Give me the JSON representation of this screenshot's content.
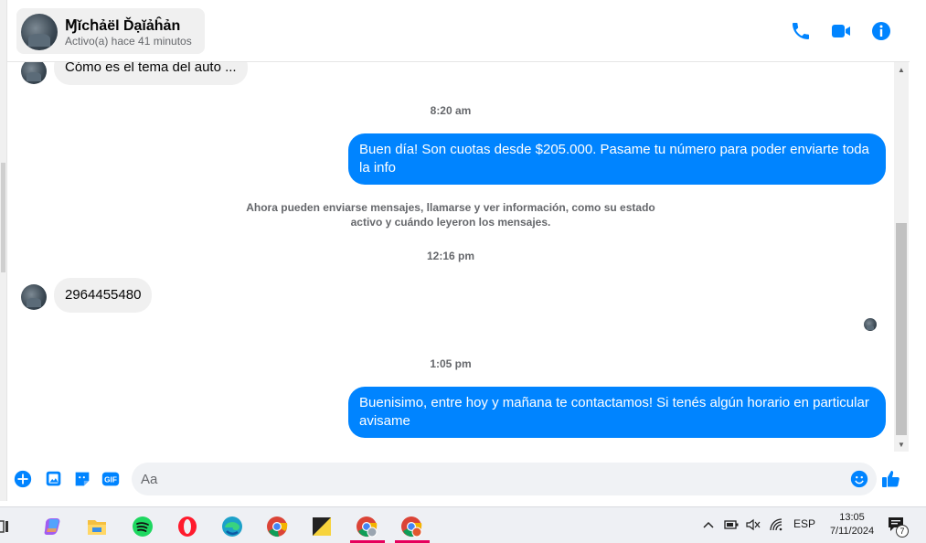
{
  "header": {
    "contact_name": "Ɱĭcհảël Ďạĭảĥản",
    "status": "Activo(a) hace 41 minutos"
  },
  "messages": {
    "prev_incoming": "Cómo es el tema del auto ...",
    "time_1": "8:20 am",
    "outgoing_1": "Buen día! Son cuotas desde $205.000. Pasame tu número para poder enviarte toda la info",
    "system_line_1": "Ahora pueden enviarse mensajes, llamarse y ver información, como su estado",
    "system_line_2": "activo y cuándo leyeron los mensajes.",
    "time_2": "12:16 pm",
    "incoming_1": "2964455480",
    "time_3": "1:05 pm",
    "outgoing_2": "Buenisimo, entre hoy y mañana te contactamos! Si tenés algún horario en particular avisame"
  },
  "composer": {
    "placeholder": "Aa"
  },
  "taskbar": {
    "language": "ESP",
    "time": "13:05",
    "date": "7/11/2024",
    "notification_count": "7"
  },
  "colors": {
    "accent": "#0084ff",
    "incoming_bubble": "#f0f0f0"
  },
  "icons": [
    "phone-icon",
    "video-icon",
    "info-icon",
    "plus-icon",
    "image-icon",
    "sticker-icon",
    "gif-icon",
    "emoji-icon",
    "like-icon"
  ]
}
